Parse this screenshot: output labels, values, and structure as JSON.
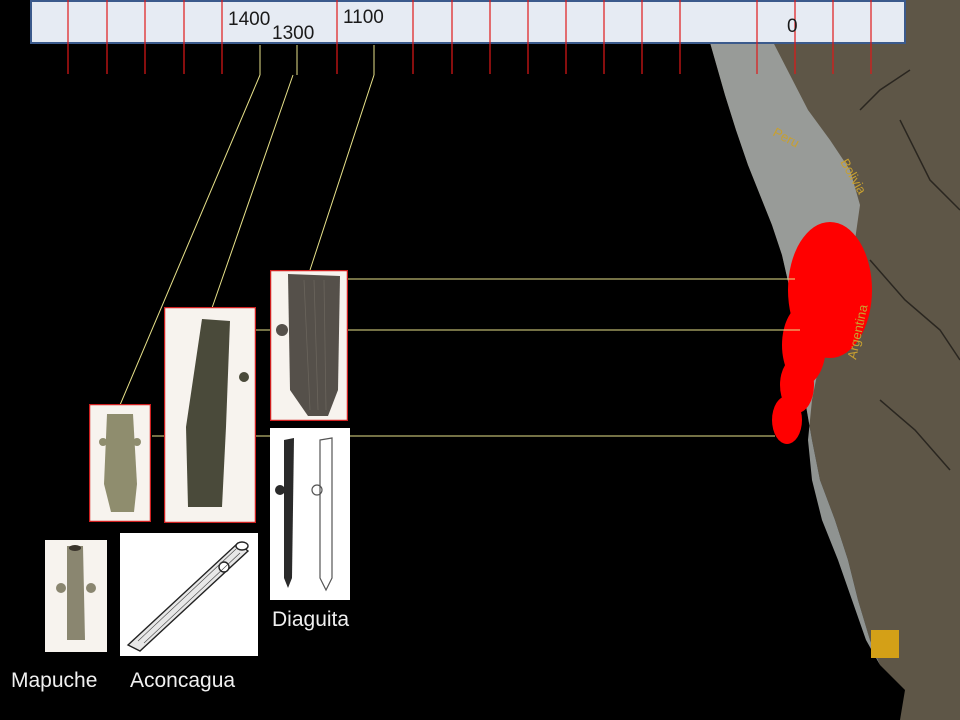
{
  "timeline": {
    "labels": [
      "1400",
      "1300",
      "1100",
      "0"
    ],
    "tick_color": "#e01818",
    "marker_color": "#e8e28a"
  },
  "map": {
    "country_labels": [
      "Peru",
      "Bolivia",
      "Argentina"
    ],
    "land_color": "#5e5647",
    "coast_color": "#9fa3a1",
    "range_color": "#ff0000"
  },
  "cultures": {
    "mapuche": "Mapuche",
    "aconcagua": "Aconcagua",
    "diaguita": "Diaguita"
  },
  "legend": {
    "color": "#d4a017"
  }
}
